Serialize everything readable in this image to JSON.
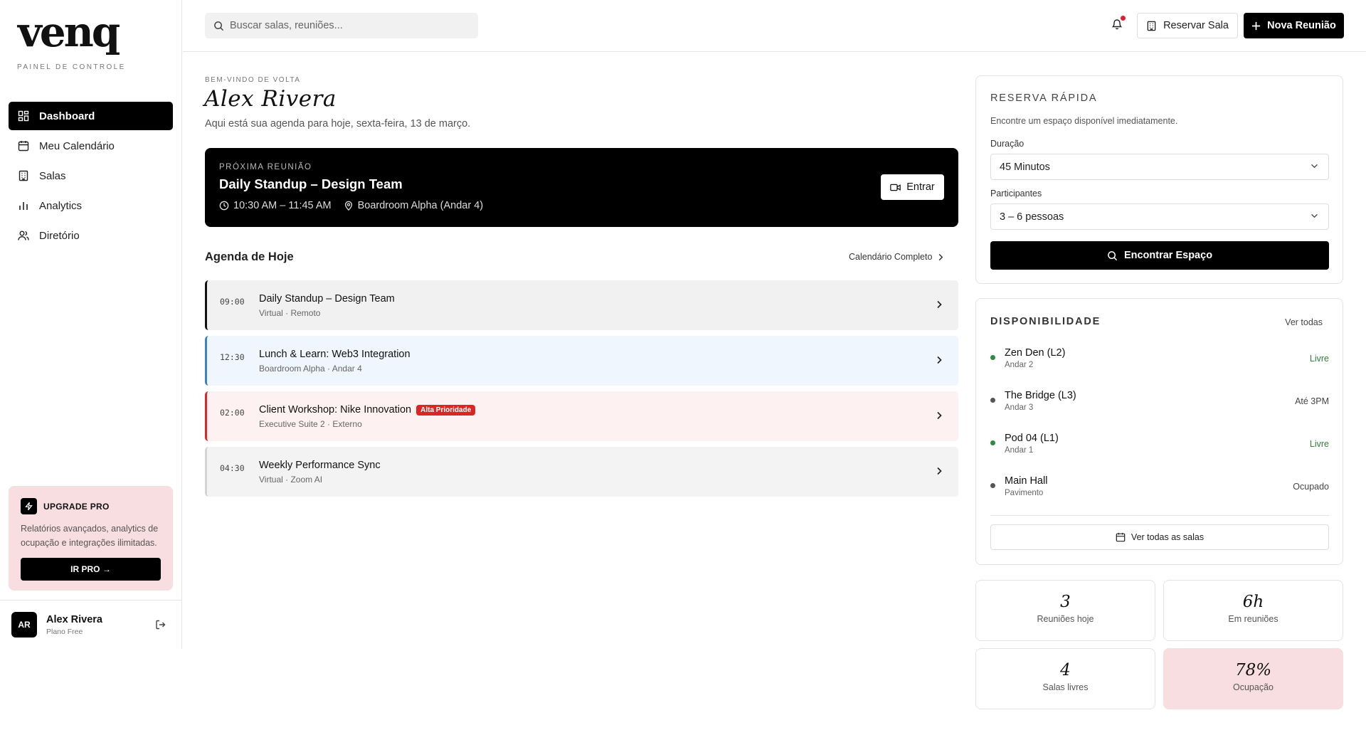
{
  "brand": {
    "logo": "venq",
    "subtitle": "PAINEL DE CONTROLE"
  },
  "sidebar": {
    "items": [
      {
        "label": "Dashboard",
        "icon": "grid-icon",
        "active": true
      },
      {
        "label": "Meu Calendário",
        "icon": "calendar-icon"
      },
      {
        "label": "Salas",
        "icon": "building-icon"
      },
      {
        "label": "Analytics",
        "icon": "bar-chart-icon"
      },
      {
        "label": "Diretório",
        "icon": "users-icon"
      }
    ],
    "upgrade": {
      "title": "UPGRADE PRO",
      "text": "Relatórios avançados, analytics de ocupação e integrações ilimitadas.",
      "button": "IR PRO →"
    },
    "user": {
      "initials": "AR",
      "name": "Alex Rivera",
      "plan": "Plano Free"
    }
  },
  "header": {
    "search_placeholder": "Buscar salas, reuniões...",
    "reserve_label": "Reservar Sala",
    "new_meeting_label": "Nova Reunião"
  },
  "main": {
    "welcome": "BEM-VINDO DE VOLTA",
    "name": "Alex Rivera",
    "subtitle": "Aqui está sua agenda para hoje, sexta-feira, 13 de março.",
    "next": {
      "label": "PRÓXIMA REUNIÃO",
      "title": "Daily Standup – Design Team",
      "time": "10:30 AM – 11:45 AM",
      "location": "Boardroom Alpha (Andar 4)",
      "join_label": "Entrar"
    },
    "agenda_title": "Agenda de Hoje",
    "agenda_link": "Calendário Completo",
    "agenda": [
      {
        "time": "09:00",
        "title": "Daily Standup – Design Team",
        "sub": "Virtual · Remoto",
        "bg": "#f1f1f1",
        "border": "#111111"
      },
      {
        "time": "12:30",
        "title": "Lunch & Learn: Web3 Integration",
        "sub": "Boardroom Alpha · Andar 4",
        "bg": "#eff6fd",
        "border": "#3b82c4"
      },
      {
        "time": "02:00",
        "title": "Client Workshop: Nike Innovation",
        "sub": "Executive Suite 2 · Externo",
        "badge": "Alta Prioridade",
        "bg": "#fdf1f1",
        "border": "#dc2626"
      },
      {
        "time": "04:30",
        "title": "Weekly Performance Sync",
        "sub": "Virtual · Zoom AI",
        "bg": "#f3f3f3",
        "border": "#d4d4d4"
      }
    ]
  },
  "quick": {
    "title": "RESERVA RÁPIDA",
    "desc": "Encontre um espaço disponível imediatamente.",
    "duration_label": "Duração",
    "duration_value": "45 Minutos",
    "participants_label": "Participantes",
    "participants_value": "3 – 6 pessoas",
    "button": "Encontrar Espaço"
  },
  "availability": {
    "title": "DISPONIBILIDADE",
    "link": "Ver todas",
    "rooms": [
      {
        "name": "Zen Den (L2)",
        "floor": "Andar 2",
        "status": "Livre",
        "color": "#2e8b3e"
      },
      {
        "name": "The Bridge (L3)",
        "floor": "Andar 3",
        "status": "Até 3PM",
        "color": "#555555"
      },
      {
        "name": "Pod 04 (L1)",
        "floor": "Andar 1",
        "status": "Livre",
        "color": "#2e8b3e"
      },
      {
        "name": "Main Hall",
        "floor": "Pavimento",
        "status": "Ocupado",
        "color": "#555555"
      }
    ],
    "all_rooms": "Ver todas as salas"
  },
  "stats": [
    {
      "value": "3",
      "label": "Reuniões hoje"
    },
    {
      "value": "6h",
      "label": "Em reuniões"
    },
    {
      "value": "4",
      "label": "Salas livres"
    },
    {
      "value": "78%",
      "label": "Ocupação"
    }
  ]
}
